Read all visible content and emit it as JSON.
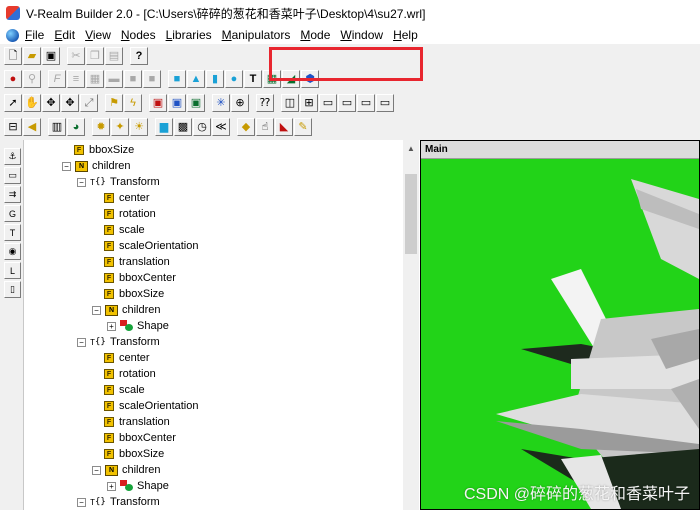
{
  "window": {
    "title": "V-Realm Builder 2.0 - [C:\\Users\\碎碎的葱花和香菜叶子\\Desktop\\4\\su27.wrl]"
  },
  "menu": {
    "items": [
      {
        "label": "File",
        "key": "F"
      },
      {
        "label": "Edit",
        "key": "E"
      },
      {
        "label": "View",
        "key": "V"
      },
      {
        "label": "Nodes",
        "key": "N"
      },
      {
        "label": "Libraries",
        "key": "L"
      },
      {
        "label": "Manipulators",
        "key": "M"
      },
      {
        "label": "Mode",
        "key": "M"
      },
      {
        "label": "Window",
        "key": "W"
      },
      {
        "label": "Help",
        "key": "H"
      }
    ]
  },
  "tree": {
    "rows": [
      {
        "indent": 0,
        "type": "field",
        "label": "bboxSize"
      },
      {
        "indent": 0,
        "type": "children",
        "expander": "⊟",
        "label": "children"
      },
      {
        "indent": 1,
        "type": "transform",
        "expander": "⊟",
        "label": "Transform"
      },
      {
        "indent": 2,
        "type": "field",
        "label": "center"
      },
      {
        "indent": 2,
        "type": "field",
        "label": "rotation"
      },
      {
        "indent": 2,
        "type": "field",
        "label": "scale"
      },
      {
        "indent": 2,
        "type": "field",
        "label": "scaleOrientation"
      },
      {
        "indent": 2,
        "type": "field",
        "label": "translation"
      },
      {
        "indent": 2,
        "type": "field",
        "label": "bboxCenter"
      },
      {
        "indent": 2,
        "type": "field",
        "label": "bboxSize"
      },
      {
        "indent": 2,
        "type": "children",
        "expander": "⊟",
        "label": "children"
      },
      {
        "indent": 3,
        "type": "shape",
        "expander": "⊞",
        "label": "Shape"
      },
      {
        "indent": 1,
        "type": "transform",
        "expander": "⊟",
        "label": "Transform"
      },
      {
        "indent": 2,
        "type": "field",
        "label": "center"
      },
      {
        "indent": 2,
        "type": "field",
        "label": "rotation"
      },
      {
        "indent": 2,
        "type": "field",
        "label": "scale"
      },
      {
        "indent": 2,
        "type": "field",
        "label": "scaleOrientation"
      },
      {
        "indent": 2,
        "type": "field",
        "label": "translation"
      },
      {
        "indent": 2,
        "type": "field",
        "label": "bboxCenter"
      },
      {
        "indent": 2,
        "type": "field",
        "label": "bboxSize"
      },
      {
        "indent": 2,
        "type": "children",
        "expander": "⊟",
        "label": "children"
      },
      {
        "indent": 3,
        "type": "shape",
        "expander": "⊞",
        "label": "Shape"
      },
      {
        "indent": 1,
        "type": "transform",
        "expander": "⊟",
        "label": "Transform"
      }
    ]
  },
  "main_view": {
    "title": "Main"
  },
  "watermark": "CSDN @碎碎的葱花和香菜叶子",
  "colors": {
    "viewport_bg": "#22d318",
    "highlight": "#e8262f"
  }
}
